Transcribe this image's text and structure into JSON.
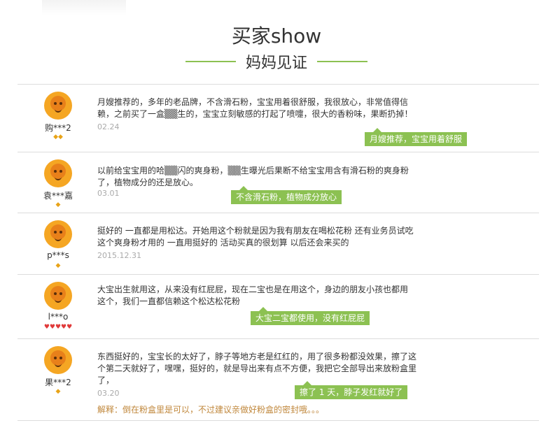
{
  "header": {
    "title": "买家show",
    "subtitle": "妈妈见证"
  },
  "reviews": [
    {
      "user": "购***2",
      "badge": "◆◆",
      "text": "月嫂推荐的，多年的老品牌，不含滑石粉，宝宝用着很舒服，我很放心，非常值得信赖，之前买了一盒▒▒生的，宝宝立刻敏感的打起了喷嚏，很大的香粉味，果断扔掉！",
      "date": "02.24",
      "tag": "月嫂推荐，宝宝用着舒服"
    },
    {
      "user": "袁***嘉",
      "badge": "◆",
      "text": "以前给宝宝用的哈▒▒闪的爽身粉，▒▒生曝光后果断不给宝宝用含有滑石粉的爽身粉了，植物成分的还是放心。",
      "date": "03.01",
      "tag": "不含滑石粉，植物成分放心"
    },
    {
      "user": "p***s",
      "badge": "◆",
      "text": "挺好的 一直都是用松达。开始用这个粉就是因为我有朋友在喝松花粉 还有业务员试吃这个爽身粉才用的 一直用挺好的 活动买真的很划算 以后还会来买的",
      "date": "2015.12.31",
      "tag": ""
    },
    {
      "user": "l***o",
      "badge": "♥♥♥♥♥",
      "text": "大宝出生就用这，从来没有红屁屁，现在二宝也是在用这个，身边的朋友小孩也都用这个，我们一直都信赖这个松达松花粉",
      "date": "",
      "tag": "大宝二宝都使用，没有红屁屁"
    },
    {
      "user": "果***2",
      "badge": "◆",
      "text": "东西挺好的，宝宝长的太好了，脖子等地方老是红红的，用了很多粉都没效果，擦了这个第二天就好了，嘿嘿，挺好的，就是导出来有点不方便，我把它全部导出来放粉盒里了，",
      "date": "03.20",
      "tag": "擦了 1 天，脖子发红就好了",
      "explain": "解释：倒在粉盒里是可以，不过建议亲做好粉盒的密封哦。。。"
    }
  ]
}
